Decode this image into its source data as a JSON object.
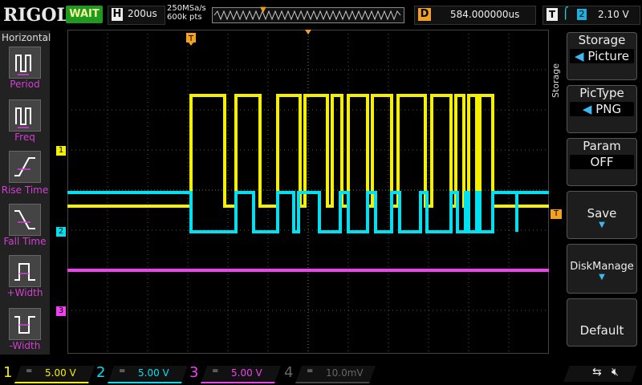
{
  "header": {
    "logo": "RIGOL",
    "run_state": "WAIT",
    "timebase_key": "H",
    "timebase_value": "200us",
    "sample_rate": "250MSa/s",
    "memory_depth": "600k pts",
    "delay_key": "D",
    "delay_value": "584.000000us",
    "trigger_key": "T",
    "trigger_edge": "rising-edge-icon",
    "trigger_source": "2",
    "trigger_level": "2.10 V"
  },
  "left_panel": {
    "title": "Horizontal",
    "items": [
      {
        "label": "Period"
      },
      {
        "label": "Freq"
      },
      {
        "label": "Rise Time"
      },
      {
        "label": "Fall Time"
      },
      {
        "label": "+Width"
      },
      {
        "label": "-Width"
      }
    ]
  },
  "waveform": {
    "trigger_marker": "T",
    "trigger_level_marker": "T",
    "ch1_marker": "1",
    "ch2_marker": "2",
    "ch3_marker": "3"
  },
  "right_menu": {
    "side_label": "Storage",
    "title": "Storage",
    "storage_value": "Picture",
    "pictype_title": "PicType",
    "pictype_value": "PNG",
    "param_title": "Param",
    "param_value": "OFF",
    "save_label": "Save",
    "disk_label": "DiskManage",
    "default_label": "Default"
  },
  "channels": [
    {
      "num": "1",
      "coupling": "=",
      "scale": "5.00 V",
      "color": "#f4f000"
    },
    {
      "num": "2",
      "coupling": "=",
      "scale": "5.00 V",
      "color": "#00e0f0"
    },
    {
      "num": "3",
      "coupling": "=",
      "scale": "5.00 V",
      "color": "#f040f0"
    },
    {
      "num": "4",
      "coupling": "=",
      "scale": "10.0mV",
      "color": "#555555"
    }
  ],
  "status": {
    "usb_icon": "usb-icon",
    "mute_icon": "speaker-mute-icon"
  }
}
